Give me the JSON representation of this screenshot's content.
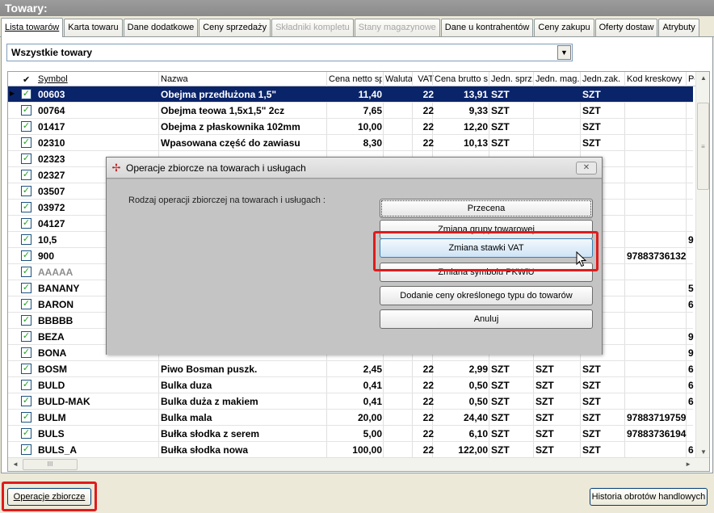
{
  "window": {
    "title": "Towary:"
  },
  "tabs": [
    {
      "label": "Lista towarów",
      "state": "active"
    },
    {
      "label": "Karta towaru",
      "state": "normal"
    },
    {
      "label": "Dane dodatkowe",
      "state": "normal"
    },
    {
      "label": "Ceny sprzedaży",
      "state": "normal"
    },
    {
      "label": "Składniki kompletu",
      "state": "disabled"
    },
    {
      "label": "Stany magazynowe",
      "state": "disabled"
    },
    {
      "label": "Dane u kontrahentów",
      "state": "normal"
    },
    {
      "label": "Ceny zakupu",
      "state": "normal"
    },
    {
      "label": "Oferty dostaw",
      "state": "normal"
    },
    {
      "label": "Atrybuty",
      "state": "normal"
    }
  ],
  "filter": {
    "value": "Wszystkie towary"
  },
  "grid": {
    "columns": [
      {
        "key": "check",
        "label": "✔"
      },
      {
        "key": "symbol",
        "label": "Symbol"
      },
      {
        "key": "nazwa",
        "label": "Nazwa"
      },
      {
        "key": "netto",
        "label": "Cena netto sp"
      },
      {
        "key": "waluta",
        "label": "Waluta"
      },
      {
        "key": "vat",
        "label": "VAT"
      },
      {
        "key": "brutto",
        "label": "Cena brutto sp"
      },
      {
        "key": "jsprz",
        "label": "Jedn. sprz."
      },
      {
        "key": "jmag",
        "label": "Jedn. mag."
      },
      {
        "key": "jzak",
        "label": "Jedn.zak."
      },
      {
        "key": "kod",
        "label": "Kod kreskowy"
      },
      {
        "key": "extra",
        "label": "Pł"
      }
    ],
    "rows": [
      {
        "symbol": "00603",
        "nazwa": "Obejma przedłużona 1,5\"",
        "netto": "11,40",
        "vat": "22",
        "brutto": "13,91",
        "jsprz": "SZT",
        "jmag": "",
        "jzak": "SZT",
        "kod": "",
        "extra": "",
        "selected": true
      },
      {
        "symbol": "00764",
        "nazwa": "Obejma teowa 1,5x1,5\" 2cz",
        "netto": "7,65",
        "vat": "22",
        "brutto": "9,33",
        "jsprz": "SZT",
        "jmag": "",
        "jzak": "SZT",
        "kod": "",
        "extra": ""
      },
      {
        "symbol": "01417",
        "nazwa": "Obejma z płaskownika 102mm",
        "netto": "10,00",
        "vat": "22",
        "brutto": "12,20",
        "jsprz": "SZT",
        "jmag": "",
        "jzak": "SZT",
        "kod": "",
        "extra": ""
      },
      {
        "symbol": "02310",
        "nazwa": "Wpasowana część do zawiasu",
        "netto": "8,30",
        "vat": "22",
        "brutto": "10,13",
        "jsprz": "SZT",
        "jmag": "",
        "jzak": "SZT",
        "kod": "",
        "extra": ""
      },
      {
        "symbol": "02323",
        "nazwa": "",
        "netto": "",
        "vat": "",
        "brutto": "",
        "jsprz": "",
        "jmag": "",
        "jzak": "",
        "kod": "",
        "extra": ""
      },
      {
        "symbol": "02327",
        "nazwa": "",
        "netto": "",
        "vat": "",
        "brutto": "",
        "jsprz": "",
        "jmag": "",
        "jzak": "",
        "kod": "",
        "extra": ""
      },
      {
        "symbol": "03507",
        "nazwa": "",
        "netto": "",
        "vat": "",
        "brutto": "",
        "jsprz": "",
        "jmag": "",
        "jzak": "",
        "kod": "",
        "extra": ""
      },
      {
        "symbol": "03972",
        "nazwa": "",
        "netto": "",
        "vat": "",
        "brutto": "",
        "jsprz": "",
        "jmag": "",
        "jzak": "",
        "kod": "",
        "extra": ""
      },
      {
        "symbol": "04127",
        "nazwa": "",
        "netto": "",
        "vat": "",
        "brutto": "",
        "jsprz": "",
        "jmag": "",
        "jzak": "",
        "kod": "",
        "extra": ""
      },
      {
        "symbol": "10,5",
        "nazwa": "",
        "netto": "",
        "vat": "",
        "brutto": "",
        "jsprz": "",
        "jmag": "",
        "jzak": "",
        "kod": "",
        "extra": "9"
      },
      {
        "symbol": "900",
        "nazwa": "",
        "netto": "",
        "vat": "",
        "brutto": "",
        "jsprz": "",
        "jmag": "",
        "jzak": "",
        "kod": "97883736132",
        "extra": ""
      },
      {
        "symbol": "AAAAA",
        "nazwa": "",
        "netto": "",
        "vat": "",
        "brutto": "",
        "jsprz": "",
        "jmag": "",
        "jzak": "",
        "kod": "",
        "extra": "",
        "gray": true
      },
      {
        "symbol": "BANANY",
        "nazwa": "",
        "netto": "",
        "vat": "",
        "brutto": "",
        "jsprz": "",
        "jmag": "",
        "jzak": "",
        "kod": "",
        "extra": "5"
      },
      {
        "symbol": "BARON",
        "nazwa": "",
        "netto": "",
        "vat": "",
        "brutto": "",
        "jsprz": "",
        "jmag": "",
        "jzak": "",
        "kod": "",
        "extra": "6"
      },
      {
        "symbol": "BBBBB",
        "nazwa": "",
        "netto": "",
        "vat": "",
        "brutto": "",
        "jsprz": "",
        "jmag": "",
        "jzak": "",
        "kod": "",
        "extra": ""
      },
      {
        "symbol": "BEZA",
        "nazwa": "",
        "netto": "",
        "vat": "",
        "brutto": "",
        "jsprz": "",
        "jmag": "",
        "jzak": "",
        "kod": "",
        "extra": "9"
      },
      {
        "symbol": "BONA",
        "nazwa": "",
        "netto": "",
        "vat": "",
        "brutto": "",
        "jsprz": "",
        "jmag": "",
        "jzak": "",
        "kod": "",
        "extra": "9"
      },
      {
        "symbol": "BOSM",
        "nazwa": "Piwo Bosman puszk.",
        "netto": "2,45",
        "vat": "22",
        "brutto": "2,99",
        "jsprz": "SZT",
        "jmag": "SZT",
        "jzak": "SZT",
        "kod": "",
        "extra": "6"
      },
      {
        "symbol": "BULD",
        "nazwa": "Bulka duza",
        "netto": "0,41",
        "vat": "22",
        "brutto": "0,50",
        "jsprz": "SZT",
        "jmag": "SZT",
        "jzak": "SZT",
        "kod": "",
        "extra": "6"
      },
      {
        "symbol": "BULD-MAK",
        "nazwa": "Bulka duża z makiem",
        "netto": "0,41",
        "vat": "22",
        "brutto": "0,50",
        "jsprz": "SZT",
        "jmag": "SZT",
        "jzak": "SZT",
        "kod": "",
        "extra": "6"
      },
      {
        "symbol": "BULM",
        "nazwa": "Bulka mala",
        "netto": "20,00",
        "vat": "22",
        "brutto": "24,40",
        "jsprz": "SZT",
        "jmag": "SZT",
        "jzak": "SZT",
        "kod": "97883719759",
        "extra": ""
      },
      {
        "symbol": "BULS",
        "nazwa": "Bułka słodka z serem",
        "netto": "5,00",
        "vat": "22",
        "brutto": "6,10",
        "jsprz": "SZT",
        "jmag": "SZT",
        "jzak": "SZT",
        "kod": "97883736194",
        "extra": ""
      },
      {
        "symbol": "BULS_A",
        "nazwa": "Bułka słodka nowa",
        "netto": "100,00",
        "vat": "22",
        "brutto": "122,00",
        "jsprz": "SZT",
        "jmag": "SZT",
        "jzak": "SZT",
        "kod": "",
        "extra": "6"
      }
    ]
  },
  "footer": {
    "operacje_label": "Operacje zbiorcze",
    "historia_label": "Historia obrotów handlowych"
  },
  "dialog": {
    "title": "Operacje zbiorcze na towarach i usługach",
    "prompt": "Rodzaj operacji zbiorczej na towarach i usługach :",
    "buttons": [
      {
        "label": "Przecena"
      },
      {
        "label": "Zmiana grupy towarowej"
      },
      {
        "label": "Zmiana stawki VAT"
      },
      {
        "label": "Zmiana symbolu PKWiU"
      },
      {
        "label": "Dodanie ceny określonego typu do towarów"
      },
      {
        "label": "Anuluj"
      }
    ]
  },
  "colors": {
    "highlight": "#e01b1b",
    "selection": "#0a246a"
  }
}
